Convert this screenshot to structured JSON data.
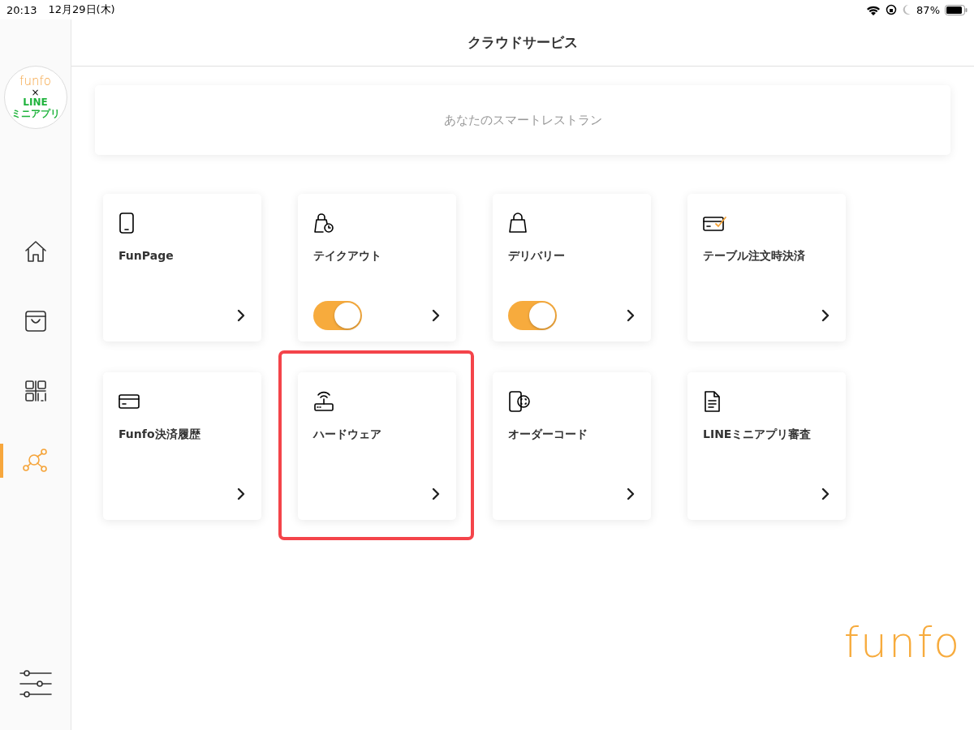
{
  "status_bar": {
    "time": "20:13",
    "date": "12月29日(木)",
    "battery": "87%"
  },
  "sidebar": {
    "logo": {
      "brand": "funfo",
      "cross": "×",
      "partner": "LINE",
      "partner_app": "ミニアプリ"
    },
    "items": [
      {
        "selected": false
      },
      {
        "selected": false
      },
      {
        "selected": false
      },
      {
        "selected": true
      }
    ]
  },
  "header": {
    "title": "クラウドサービス"
  },
  "banner": {
    "text": "あなたのスマートレストラン"
  },
  "cards": [
    {
      "label": "FunPage",
      "highlighted": false
    },
    {
      "label": "テイクアウト",
      "highlighted": false,
      "toggle": {
        "on": true
      }
    },
    {
      "label": "デリバリー",
      "highlighted": false,
      "toggle": {
        "on": true
      }
    },
    {
      "label": "テーブル注文時決済",
      "highlighted": false
    },
    {
      "label": "Funfo決済履歴",
      "highlighted": false
    },
    {
      "label": "ハードウェア",
      "highlighted": true
    },
    {
      "label": "オーダーコード",
      "highlighted": false
    },
    {
      "label": "LINEミニアプリ審査",
      "highlighted": false
    }
  ],
  "footer_logo": "funfo"
}
